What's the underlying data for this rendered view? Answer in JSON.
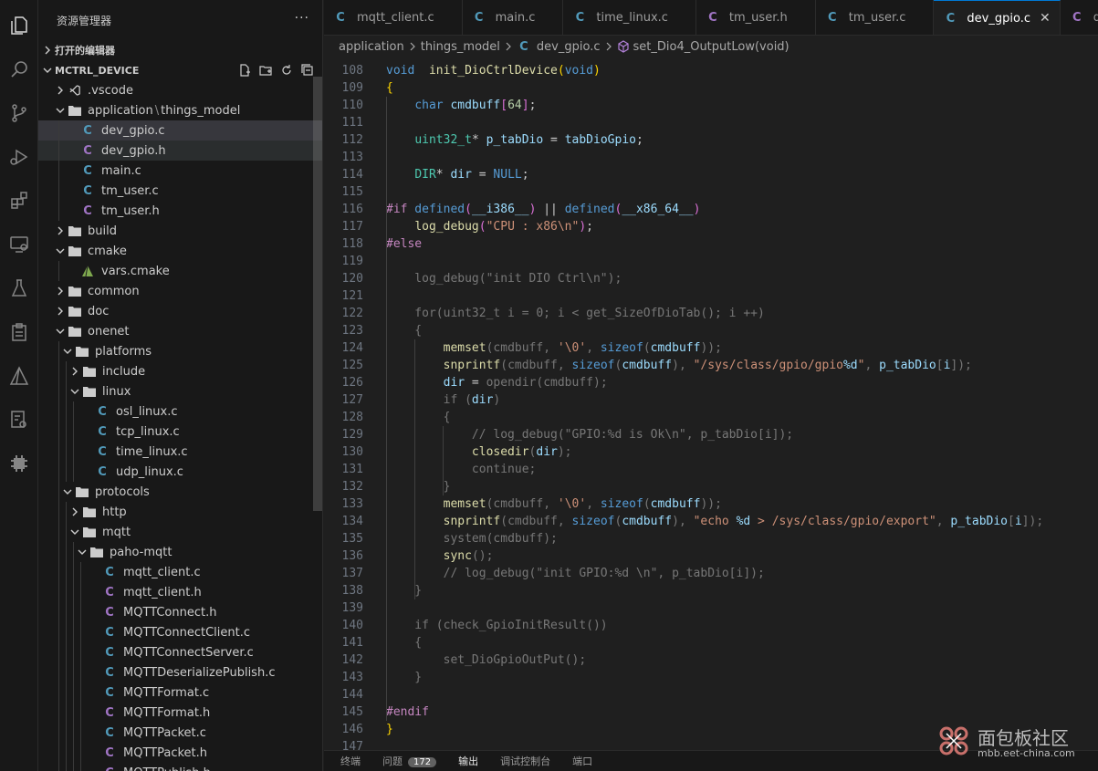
{
  "explorer": {
    "title": "资源管理器",
    "more": "···",
    "open_editors": "打开的编辑器",
    "project": "MCTRL_DEVICE"
  },
  "tree": [
    {
      "label": ".vscode",
      "type": "folder",
      "depth": 1,
      "expanded": false,
      "icon": "vscode-icon"
    },
    {
      "label": "application",
      "label2": "things_model",
      "type": "folder",
      "depth": 1,
      "expanded": true
    },
    {
      "label": "dev_gpio.c",
      "type": "c",
      "depth": 2,
      "state": "selected"
    },
    {
      "label": "dev_gpio.h",
      "type": "h",
      "depth": 2,
      "state": "hover"
    },
    {
      "label": "main.c",
      "type": "c",
      "depth": 2
    },
    {
      "label": "tm_user.c",
      "type": "c",
      "depth": 2
    },
    {
      "label": "tm_user.h",
      "type": "h",
      "depth": 2
    },
    {
      "label": "build",
      "type": "folder",
      "depth": 1,
      "expanded": false
    },
    {
      "label": "cmake",
      "type": "folder",
      "depth": 1,
      "expanded": true
    },
    {
      "label": "vars.cmake",
      "type": "cmake",
      "depth": 2
    },
    {
      "label": "common",
      "type": "folder",
      "depth": 1,
      "expanded": false
    },
    {
      "label": "doc",
      "type": "folder",
      "depth": 1,
      "expanded": false
    },
    {
      "label": "onenet",
      "type": "folder",
      "depth": 1,
      "expanded": true
    },
    {
      "label": "platforms",
      "type": "folder",
      "depth": 2,
      "expanded": true
    },
    {
      "label": "include",
      "type": "folder",
      "depth": 3,
      "expanded": false
    },
    {
      "label": "linux",
      "type": "folder",
      "depth": 3,
      "expanded": true
    },
    {
      "label": "osl_linux.c",
      "type": "c",
      "depth": 4
    },
    {
      "label": "tcp_linux.c",
      "type": "c",
      "depth": 4
    },
    {
      "label": "time_linux.c",
      "type": "c",
      "depth": 4
    },
    {
      "label": "udp_linux.c",
      "type": "c",
      "depth": 4
    },
    {
      "label": "protocols",
      "type": "folder",
      "depth": 2,
      "expanded": true
    },
    {
      "label": "http",
      "type": "folder",
      "depth": 3,
      "expanded": false
    },
    {
      "label": "mqtt",
      "type": "folder",
      "depth": 3,
      "expanded": true
    },
    {
      "label": "paho-mqtt",
      "type": "folder",
      "depth": 4,
      "expanded": true
    },
    {
      "label": "mqtt_client.c",
      "type": "c",
      "depth": 5
    },
    {
      "label": "mqtt_client.h",
      "type": "h",
      "depth": 5
    },
    {
      "label": "MQTTConnect.h",
      "type": "h",
      "depth": 5
    },
    {
      "label": "MQTTConnectClient.c",
      "type": "c",
      "depth": 5
    },
    {
      "label": "MQTTConnectServer.c",
      "type": "c",
      "depth": 5
    },
    {
      "label": "MQTTDeserializePublish.c",
      "type": "c",
      "depth": 5
    },
    {
      "label": "MQTTFormat.c",
      "type": "c",
      "depth": 5
    },
    {
      "label": "MQTTFormat.h",
      "type": "h",
      "depth": 5
    },
    {
      "label": "MQTTPacket.c",
      "type": "c",
      "depth": 5
    },
    {
      "label": "MQTTPacket.h",
      "type": "h",
      "depth": 5
    },
    {
      "label": "MQTTPublish.h",
      "type": "h",
      "depth": 5
    }
  ],
  "tabs": [
    {
      "label": "mqtt_client.c",
      "type": "c"
    },
    {
      "label": "main.c",
      "type": "c"
    },
    {
      "label": "time_linux.c",
      "type": "c"
    },
    {
      "label": "tm_user.h",
      "type": "h"
    },
    {
      "label": "tm_user.c",
      "type": "c"
    },
    {
      "label": "dev_gpio.c",
      "type": "c",
      "active": true,
      "close": "✕"
    },
    {
      "label": "dev_gpio.h",
      "type": "h"
    }
  ],
  "breadcrumb": {
    "parts": [
      "application",
      "things_model"
    ],
    "file": "dev_gpio.c",
    "symbol": "set_Dio4_OutputLow(void)"
  },
  "code": [
    {
      "n": "108",
      "segs": [
        [
          "kw",
          "void"
        ],
        [
          "",
          "  "
        ],
        [
          "fn",
          "init_DioCtrlDevice"
        ],
        [
          "br1",
          "("
        ],
        [
          "kw",
          "void"
        ],
        [
          "br1",
          ")"
        ]
      ]
    },
    {
      "n": "109",
      "segs": [
        [
          "br1",
          "{"
        ]
      ]
    },
    {
      "n": "110",
      "segs": [
        [
          "",
          "    "
        ],
        [
          "kw",
          "char"
        ],
        [
          "",
          ""
        ],
        [
          "var",
          " cmdbuff"
        ],
        [
          "br2",
          "["
        ],
        [
          "num",
          "64"
        ],
        [
          "br2",
          "]"
        ],
        [
          "",
          ";"
        ]
      ]
    },
    {
      "n": "111",
      "segs": []
    },
    {
      "n": "112",
      "segs": [
        [
          "",
          "    "
        ],
        [
          "typ",
          "uint32_t"
        ],
        [
          "",
          "* "
        ],
        [
          "var",
          "p_tabDio"
        ],
        [
          "",
          " = "
        ],
        [
          "var",
          "tabDioGpio"
        ],
        [
          "",
          ";"
        ]
      ]
    },
    {
      "n": "113",
      "segs": []
    },
    {
      "n": "114",
      "segs": [
        [
          "",
          "    "
        ],
        [
          "typ",
          "DIR"
        ],
        [
          "",
          "* "
        ],
        [
          "var",
          "dir"
        ],
        [
          "",
          " = "
        ],
        [
          "kw",
          "NULL"
        ],
        [
          "",
          ";"
        ]
      ]
    },
    {
      "n": "115",
      "segs": []
    },
    {
      "n": "116",
      "segs": [
        [
          "ctl",
          "#if"
        ],
        [
          "kw",
          " defined"
        ],
        [
          "br2",
          "("
        ],
        [
          "var",
          "__i386__"
        ],
        [
          "br2",
          ")"
        ],
        [
          "",
          " || "
        ],
        [
          "kw",
          "defined"
        ],
        [
          "br2",
          "("
        ],
        [
          "var",
          "__x86_64__"
        ],
        [
          "br2",
          ")"
        ]
      ]
    },
    {
      "n": "117",
      "segs": [
        [
          "",
          "    "
        ],
        [
          "fn",
          "log_debug"
        ],
        [
          "br2",
          "("
        ],
        [
          "str",
          "\"CPU : x86\\n\""
        ],
        [
          "br2",
          ")"
        ],
        [
          "",
          ";"
        ]
      ]
    },
    {
      "n": "118",
      "segs": [
        [
          "ctl",
          "#else"
        ]
      ]
    },
    {
      "n": "119",
      "segs": []
    },
    {
      "n": "120",
      "segs": [
        [
          "dim",
          "    log_debug(\"init DIO Ctrl\\n\");"
        ]
      ]
    },
    {
      "n": "121",
      "segs": []
    },
    {
      "n": "122",
      "segs": [
        [
          "dim",
          "    for(uint32_t i = 0; i < get_SizeOfDioTab(); i ++)"
        ]
      ]
    },
    {
      "n": "123",
      "segs": [
        [
          "dim",
          "    {"
        ]
      ]
    },
    {
      "n": "124",
      "segs": [
        [
          "",
          "        "
        ],
        [
          "fn",
          "memset"
        ],
        [
          "dim",
          "(cmdbuff, "
        ],
        [
          "str",
          "'\\0'"
        ],
        [
          "dim",
          ", "
        ],
        [
          "kw",
          "sizeof"
        ],
        [
          "dim",
          "("
        ],
        [
          "var",
          "cmdbuff"
        ],
        [
          "dim",
          "));"
        ]
      ]
    },
    {
      "n": "125",
      "segs": [
        [
          "",
          "        "
        ],
        [
          "fn",
          "snprintf"
        ],
        [
          "dim",
          "(cmdbuff, "
        ],
        [
          "kw",
          "sizeof"
        ],
        [
          "dim",
          "("
        ],
        [
          "var",
          "cmdbuff"
        ],
        [
          "dim",
          "), "
        ],
        [
          "str",
          "\"/sys/class/gpio/gpio"
        ],
        [
          "var",
          "%d"
        ],
        [
          "str",
          "\""
        ],
        [
          "dim",
          ", "
        ],
        [
          "var",
          "p_tabDio"
        ],
        [
          "dim",
          "["
        ],
        [
          "var",
          "i"
        ],
        [
          "dim",
          "]);"
        ]
      ]
    },
    {
      "n": "126",
      "segs": [
        [
          "",
          "        "
        ],
        [
          "var",
          "dir"
        ],
        [
          "",
          " = "
        ],
        [
          "dim",
          "opendir(cmdbuff);"
        ]
      ]
    },
    {
      "n": "127",
      "segs": [
        [
          "dim",
          "        if ("
        ],
        [
          "var",
          "dir"
        ],
        [
          "dim",
          ")"
        ]
      ]
    },
    {
      "n": "128",
      "segs": [
        [
          "dim",
          "        {"
        ]
      ]
    },
    {
      "n": "129",
      "segs": [
        [
          "dim",
          "            // log_debug(\"GPIO:%d is Ok\\n\", p_tabDio[i]);"
        ]
      ]
    },
    {
      "n": "130",
      "segs": [
        [
          "",
          "            "
        ],
        [
          "fn",
          "closedir"
        ],
        [
          "dim",
          "("
        ],
        [
          "var",
          "dir"
        ],
        [
          "dim",
          ");"
        ]
      ]
    },
    {
      "n": "131",
      "segs": [
        [
          "dim",
          "            continue;"
        ]
      ]
    },
    {
      "n": "132",
      "segs": [
        [
          "dim",
          "        }"
        ]
      ]
    },
    {
      "n": "133",
      "segs": [
        [
          "",
          "        "
        ],
        [
          "fn",
          "memset"
        ],
        [
          "dim",
          "(cmdbuff, "
        ],
        [
          "str",
          "'\\0'"
        ],
        [
          "dim",
          ", "
        ],
        [
          "kw",
          "sizeof"
        ],
        [
          "dim",
          "("
        ],
        [
          "var",
          "cmdbuff"
        ],
        [
          "dim",
          "));"
        ]
      ]
    },
    {
      "n": "134",
      "segs": [
        [
          "",
          "        "
        ],
        [
          "fn",
          "snprintf"
        ],
        [
          "dim",
          "(cmdbuff, "
        ],
        [
          "kw",
          "sizeof"
        ],
        [
          "dim",
          "("
        ],
        [
          "var",
          "cmdbuff"
        ],
        [
          "dim",
          "), "
        ],
        [
          "str",
          "\"echo "
        ],
        [
          "var",
          "%d"
        ],
        [
          "str",
          " > /sys/class/gpio/export\""
        ],
        [
          "dim",
          ", "
        ],
        [
          "var",
          "p_tabDio"
        ],
        [
          "dim",
          "["
        ],
        [
          "var",
          "i"
        ],
        [
          "dim",
          "]);"
        ]
      ]
    },
    {
      "n": "135",
      "segs": [
        [
          "",
          "        "
        ],
        [
          "dim",
          "system(cmdbuff);"
        ]
      ]
    },
    {
      "n": "136",
      "segs": [
        [
          "",
          "        "
        ],
        [
          "fn",
          "sync"
        ],
        [
          "dim",
          "();"
        ]
      ]
    },
    {
      "n": "137",
      "segs": [
        [
          "dim",
          "        // log_debug(\"init GPIO:%d \\n\", p_tabDio[i]);"
        ]
      ]
    },
    {
      "n": "138",
      "segs": [
        [
          "dim",
          "    }"
        ]
      ]
    },
    {
      "n": "139",
      "segs": []
    },
    {
      "n": "140",
      "segs": [
        [
          "dim",
          "    if (check_GpioInitResult())"
        ]
      ]
    },
    {
      "n": "141",
      "segs": [
        [
          "dim",
          "    {"
        ]
      ]
    },
    {
      "n": "142",
      "segs": [
        [
          "dim",
          "        set_DioGpioOutPut();"
        ]
      ]
    },
    {
      "n": "143",
      "segs": [
        [
          "dim",
          "    }"
        ]
      ]
    },
    {
      "n": "144",
      "segs": []
    },
    {
      "n": "145",
      "segs": [
        [
          "ctl",
          "#endif"
        ]
      ]
    },
    {
      "n": "146",
      "segs": [
        [
          "br1",
          "}"
        ]
      ]
    },
    {
      "n": "147",
      "segs": []
    }
  ],
  "panel": {
    "terminal": "终端",
    "problems": "问题",
    "problems_count": "172",
    "output": "输出",
    "debug_console": "调试控制台",
    "ports": "端口"
  },
  "watermark": {
    "cn": "面包板社区",
    "url": "mbb.eet-china.com"
  },
  "colors": {
    "accent": "#0078d4",
    "c_icon": "#519aba",
    "h_icon": "#a074c4",
    "cmake_icon": "#7ea84e"
  }
}
